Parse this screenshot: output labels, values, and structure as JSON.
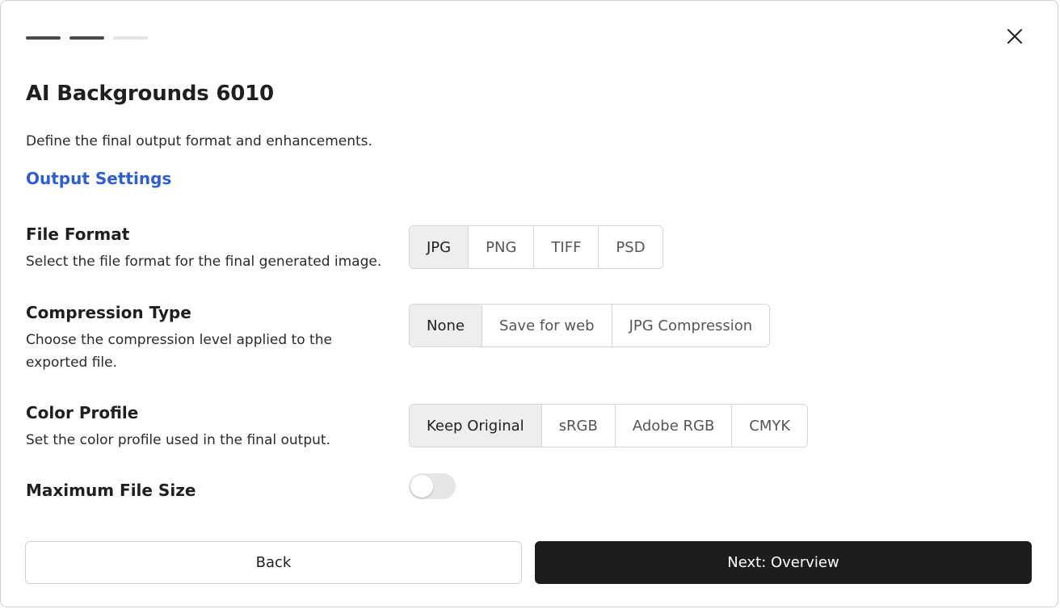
{
  "progress": {
    "total_steps": 3,
    "completed_steps": 2
  },
  "dialog": {
    "title": "AI Backgrounds 6010",
    "subtitle": "Define the final output format and enhancements.",
    "section_heading": "Output Settings",
    "close_icon": "close-icon"
  },
  "settings": {
    "file_format": {
      "label": "File Format",
      "description": "Select the file format for the final generated image.",
      "options": [
        "JPG",
        "PNG",
        "TIFF",
        "PSD"
      ],
      "selected": "JPG"
    },
    "compression_type": {
      "label": "Compression Type",
      "description": "Choose the compression level applied to the exported file.",
      "options": [
        "None",
        "Save for web",
        "JPG Compression"
      ],
      "selected": "None"
    },
    "color_profile": {
      "label": "Color Profile",
      "description": "Set the color profile used in the final output.",
      "options": [
        "Keep Original",
        "sRGB",
        "Adobe RGB",
        "CMYK"
      ],
      "selected": "Keep Original"
    },
    "max_file_size": {
      "label": "Maximum File Size",
      "enabled": false
    }
  },
  "footer": {
    "back_label": "Back",
    "next_label": "Next: Overview"
  },
  "colors": {
    "accent": "#2f5fce",
    "primary_button": "#1d1d1d",
    "selected_segment": "#eeeeee"
  }
}
